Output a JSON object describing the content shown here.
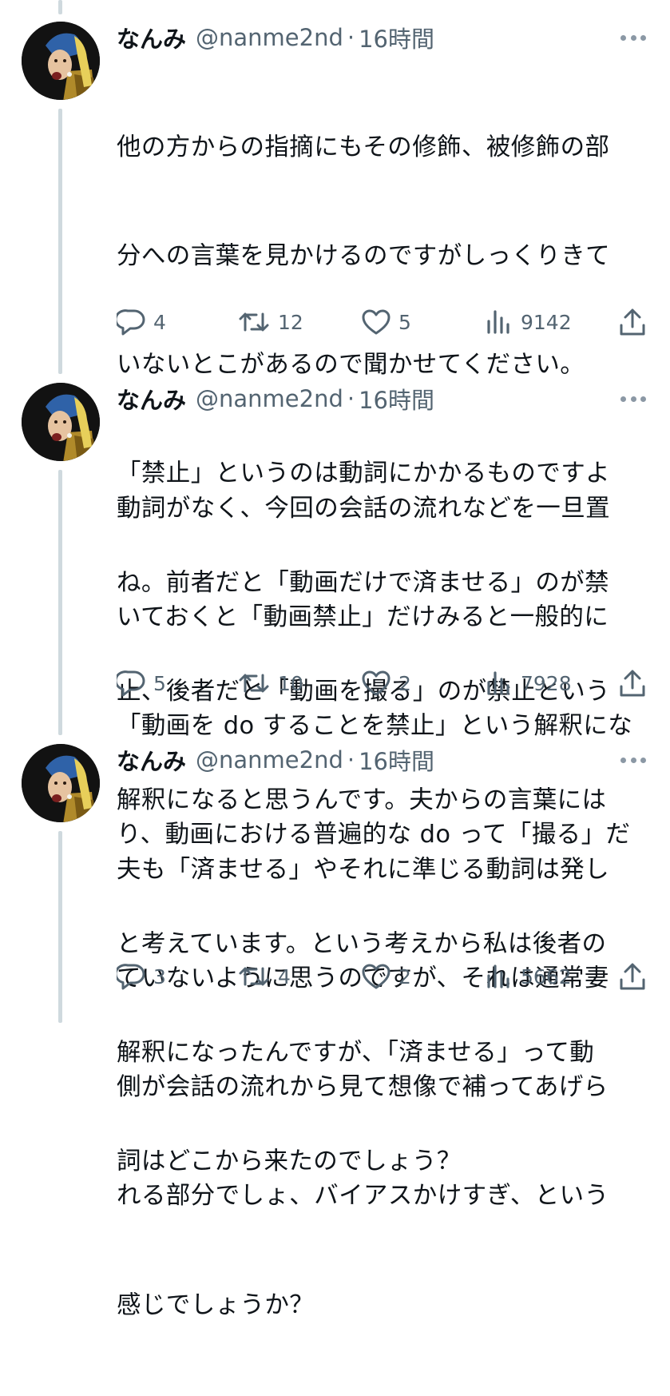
{
  "tweets": [
    {
      "author": "なんみ",
      "handle": "@nanme2nd",
      "separator": "·",
      "time": "16時間",
      "lines": [
        "他の方からの指摘にもその修飾、被修飾の部",
        "分への言葉を見かけるのですがしっくりきて",
        "いないとこがあるので聞かせてください。",
        "「禁止」というのは動詞にかかるものですよ",
        "ね。前者だと「動画だけで済ませる」のが禁",
        "止、後者だと「動画を撮る」のが禁止という",
        "解釈になると思うんです。夫からの言葉には"
      ],
      "replies": "4",
      "retweets": "12",
      "likes": "5",
      "views": "9142"
    },
    {
      "author": "なんみ",
      "handle": "@nanme2nd",
      "separator": "·",
      "time": "16時間",
      "lines": [
        "動詞がなく、今回の会話の流れなどを一旦置",
        "いておくと「動画禁止」だけみると一般的に",
        "「動画を do することを禁止」という解釈にな",
        "り、動画における普遍的な do って「撮る」だ",
        "と考えています。という考えから私は後者の",
        "解釈になったんですが、「済ませる」って動",
        "詞はどこから来たのでしょう？"
      ],
      "replies": "5",
      "retweets": "10",
      "likes": "2",
      "views": "7928"
    },
    {
      "author": "なんみ",
      "handle": "@nanme2nd",
      "separator": "·",
      "time": "16時間",
      "lines": [
        "夫も「済ませる」やそれに準じる動詞は発し",
        "ていないように思うのですが、それは通常妻",
        "側が会話の流れから見て想像で補ってあげら",
        "れる部分でしょ、バイアスかけすぎ、という",
        "感じでしょうか？"
      ],
      "replies": "3",
      "retweets": "4",
      "likes": "2",
      "views": "5662"
    }
  ],
  "icons": {
    "reply": "reply-icon",
    "retweet": "retweet-icon",
    "like": "heart-icon",
    "views": "views-icon",
    "share": "share-icon",
    "more": "more-icon"
  },
  "colors": {
    "text": "#0f1419",
    "secondary": "#536471",
    "thread_line": "#cfd9de"
  }
}
